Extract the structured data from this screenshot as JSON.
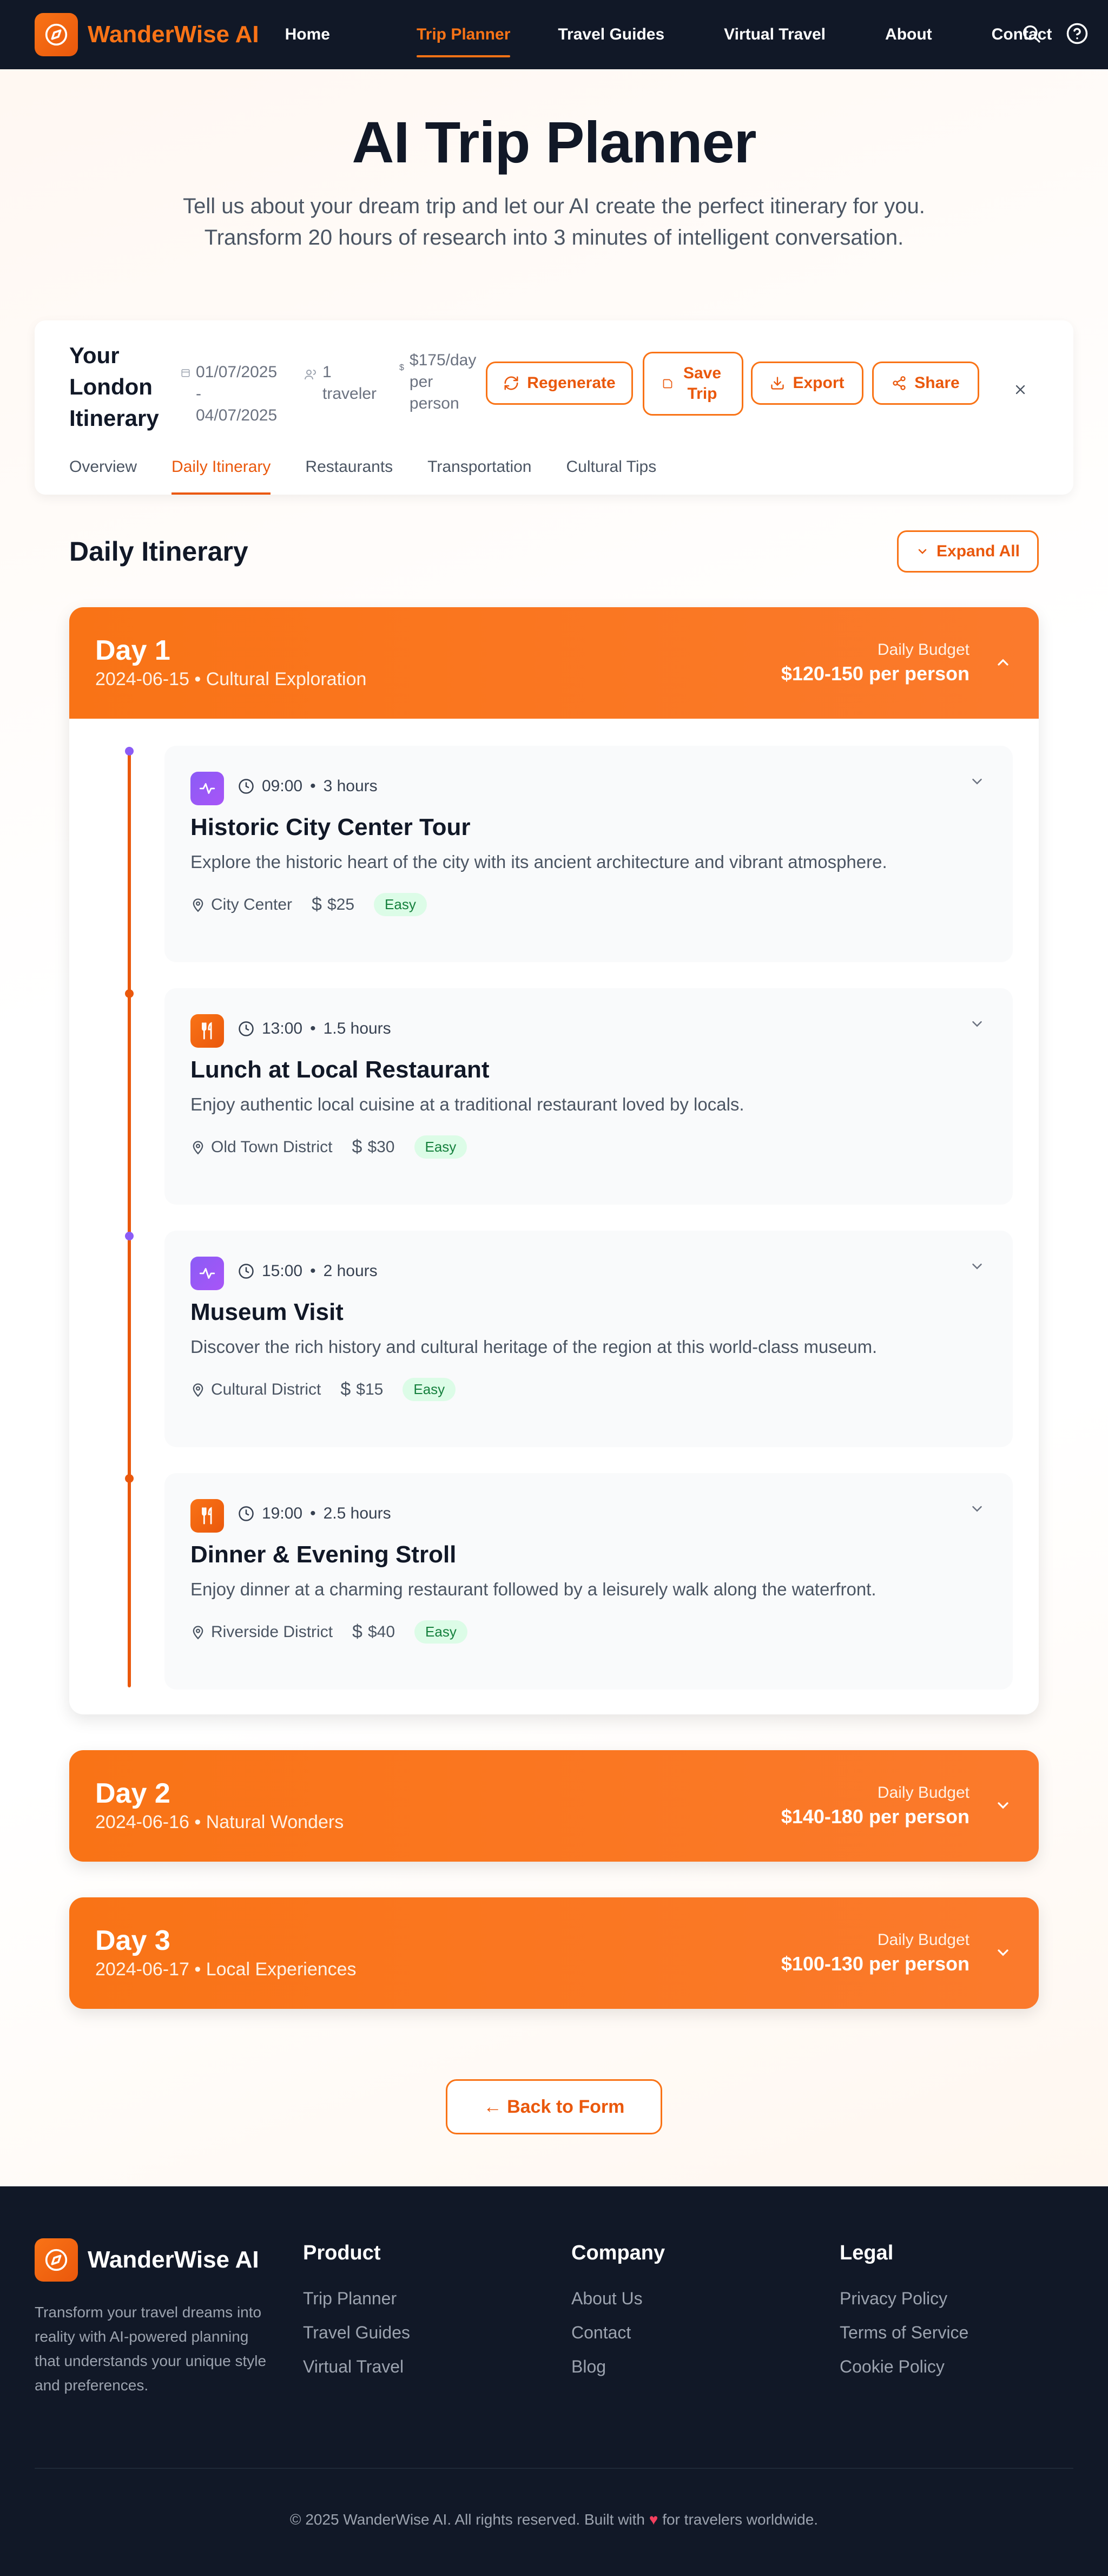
{
  "brand": {
    "name": "WanderWise AI",
    "accent": "#f97316",
    "dark": "#111827"
  },
  "nav": {
    "links": [
      "Home",
      "Trip Planner",
      "Travel Guides",
      "Virtual Travel",
      "About",
      "Contact"
    ],
    "active": "Trip Planner",
    "icons": [
      "search-icon",
      "help-circle-icon"
    ]
  },
  "hero": {
    "title": "AI Trip Planner",
    "subtitle_line1": "Tell us about your dream trip and let our AI create the perfect itinerary for you.",
    "subtitle_line2": "Transform 20 hours of research into 3 minutes of intelligent conversation."
  },
  "itinerary": {
    "title": "Your London Itinerary",
    "dates": "01/07/2025 - 04/07/2025",
    "travelers": "1 traveler",
    "budget": "$175/day per person",
    "buttons": {
      "regenerate": "Regenerate",
      "save": "Save Trip",
      "export": "Export",
      "share": "Share"
    },
    "tabs": [
      "Overview",
      "Daily Itinerary",
      "Restaurants",
      "Transportation",
      "Cultural Tips"
    ],
    "active_tab": "Daily Itinerary"
  },
  "daily": {
    "heading": "Daily Itinerary",
    "expand_all": "Expand All",
    "budget_label": "Daily Budget",
    "days": [
      {
        "title": "Day 1",
        "subtitle": "2024-06-15 • Cultural Exploration",
        "budget": "$120-150 per person",
        "expanded": true,
        "activities": [
          {
            "type": "activity",
            "time": "09:00",
            "duration": "3 hours",
            "name": "Historic City Center Tour",
            "description": "Explore the historic heart of the city with its ancient architecture and vibrant atmosphere.",
            "location": "City Center",
            "cost": "$25",
            "difficulty": "Easy"
          },
          {
            "type": "food",
            "time": "13:00",
            "duration": "1.5 hours",
            "name": "Lunch at Local Restaurant",
            "description": "Enjoy authentic local cuisine at a traditional restaurant loved by locals.",
            "location": "Old Town District",
            "cost": "$30",
            "difficulty": "Easy"
          },
          {
            "type": "activity",
            "time": "15:00",
            "duration": "2 hours",
            "name": "Museum Visit",
            "description": "Discover the rich history and cultural heritage of the region at this world-class museum.",
            "location": "Cultural District",
            "cost": "$15",
            "difficulty": "Easy"
          },
          {
            "type": "food",
            "time": "19:00",
            "duration": "2.5 hours",
            "name": "Dinner & Evening Stroll",
            "description": "Enjoy dinner at a charming restaurant followed by a leisurely walk along the waterfront.",
            "location": "Riverside District",
            "cost": "$40",
            "difficulty": "Easy"
          }
        ]
      },
      {
        "title": "Day 2",
        "subtitle": "2024-06-16 • Natural Wonders",
        "budget": "$140-180 per person",
        "expanded": false
      },
      {
        "title": "Day 3",
        "subtitle": "2024-06-17 • Local Experiences",
        "budget": "$100-130 per person",
        "expanded": false
      }
    ]
  },
  "back_button": "← Back to Form",
  "footer": {
    "about": "Transform your travel dreams into reality with AI-powered planning that understands your unique style and preferences.",
    "columns": [
      {
        "title": "Product",
        "links": [
          "Trip Planner",
          "Travel Guides",
          "Virtual Travel"
        ]
      },
      {
        "title": "Company",
        "links": [
          "About Us",
          "Contact",
          "Blog"
        ]
      },
      {
        "title": "Legal",
        "links": [
          "Privacy Policy",
          "Terms of Service",
          "Cookie Policy"
        ]
      }
    ],
    "copyright_pre": "© 2025 WanderWise AI. All rights reserved. Built with",
    "copyright_post": "for travelers worldwide."
  }
}
